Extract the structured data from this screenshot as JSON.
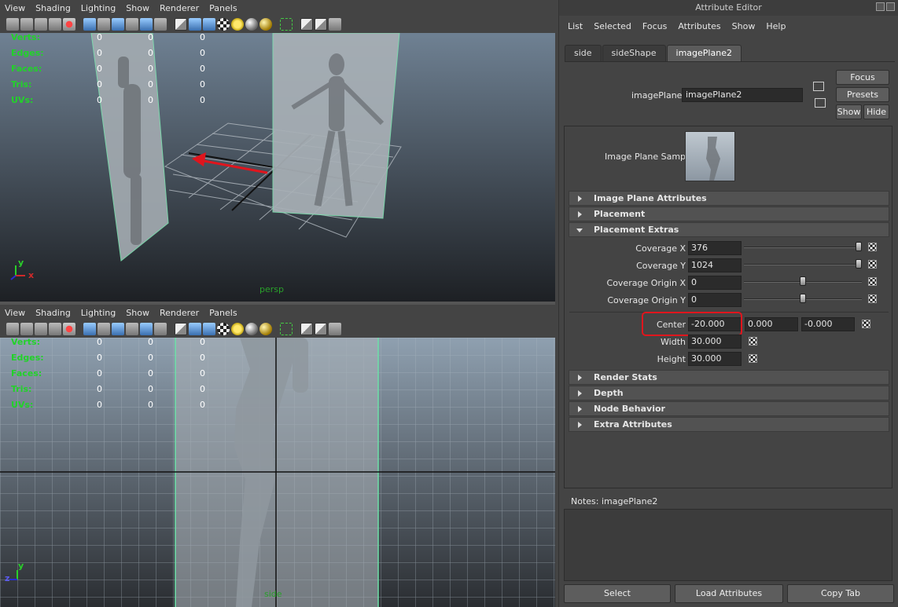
{
  "viewport_menu": [
    "View",
    "Shading",
    "Lighting",
    "Show",
    "Renderer",
    "Panels"
  ],
  "hud": {
    "rows": [
      {
        "label": "Verts:",
        "v1": "0",
        "v2": "0",
        "v3": "0"
      },
      {
        "label": "Edges:",
        "v1": "0",
        "v2": "0",
        "v3": "0"
      },
      {
        "label": "Faces:",
        "v1": "0",
        "v2": "0",
        "v3": "0"
      },
      {
        "label": "Tris:",
        "v1": "0",
        "v2": "0",
        "v3": "0"
      },
      {
        "label": "UVs:",
        "v1": "0",
        "v2": "0",
        "v3": "0"
      }
    ]
  },
  "top_viewport": {
    "camera": "persp",
    "axis_y": "y",
    "axis_x": "x"
  },
  "bottom_viewport": {
    "camera": "side",
    "axis_y": "y",
    "axis_z": "z"
  },
  "toolbar_icons": [
    "camera-select-icon",
    "camera-attributes-icon",
    "bookmarks-icon",
    "image-plane-icon",
    "grid-icon",
    "film-gate-icon",
    "resolution-gate-icon",
    "gate-mask-icon",
    "field-chart-icon",
    "safe-action-icon",
    "safe-title-icon",
    "wireframe-icon",
    "smooth-shade-icon",
    "default-material-icon",
    "textured-icon",
    "use-all-lights-icon",
    "shadows-icon",
    "high-quality-icon",
    "isolate-select-icon",
    "xray-icon",
    "xray-joints-icon",
    "backface-icon"
  ],
  "attribute_editor": {
    "title": "Attribute Editor",
    "menu": [
      "List",
      "Selected",
      "Focus",
      "Attributes",
      "Show",
      "Help"
    ],
    "tabs": [
      {
        "label": "side",
        "active": false
      },
      {
        "label": "sideShape",
        "active": false
      },
      {
        "label": "imagePlane2",
        "active": true
      }
    ],
    "node_label": "imagePlane:",
    "node_value": "imagePlane2",
    "buttons": {
      "focus": "Focus",
      "presets": "Presets",
      "show": "Show",
      "hide": "Hide"
    },
    "sample_label": "Image Plane Sample",
    "sections": {
      "image_plane_attributes": "Image Plane Attributes",
      "placement": "Placement",
      "placement_extras": "Placement Extras",
      "render_stats": "Render Stats",
      "depth": "Depth",
      "node_behavior": "Node Behavior",
      "extra_attributes": "Extra Attributes"
    },
    "coverage": [
      {
        "label": "Coverage X",
        "value": "376",
        "slider": 0.97
      },
      {
        "label": "Coverage Y",
        "value": "1024",
        "slider": 0.97
      },
      {
        "label": "Coverage Origin X",
        "value": "0",
        "slider": 0.5
      },
      {
        "label": "Coverage Origin Y",
        "value": "0",
        "slider": 0.5
      }
    ],
    "center": {
      "label": "Center",
      "x": "-20.000",
      "y": "0.000",
      "z": "-0.000"
    },
    "width": {
      "label": "Width",
      "value": "30.000"
    },
    "height": {
      "label": "Height",
      "value": "30.000"
    },
    "notes_label": "Notes:  imagePlane2",
    "bottom_buttons": {
      "select": "Select",
      "load": "Load Attributes",
      "copy": "Copy Tab"
    }
  },
  "colors": {
    "hud_green": "#22d22a",
    "highlight_red": "#e0151d",
    "arrow_red": "#e0151d"
  }
}
